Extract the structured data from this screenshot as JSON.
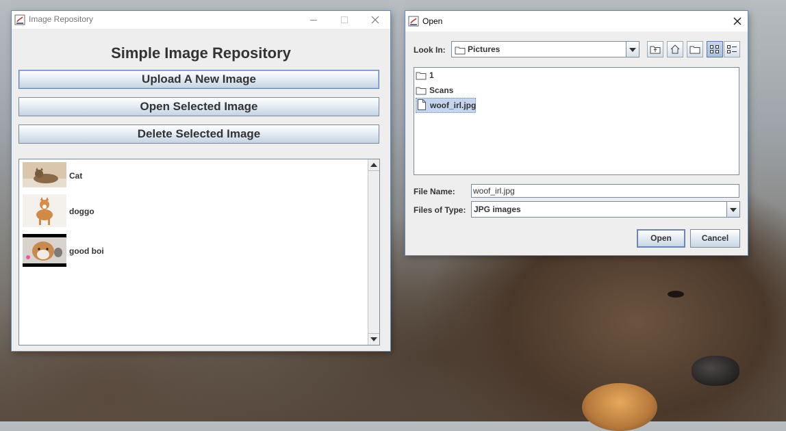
{
  "repo_window": {
    "title": "Image Repository",
    "heading": "Simple Image Repository",
    "buttons": {
      "upload": "Upload A New Image",
      "open": "Open Selected Image",
      "delete": "Delete Selected Image"
    },
    "images": [
      {
        "label": "Cat",
        "thumb": "cat-photo"
      },
      {
        "label": "doggo",
        "thumb": "shiba-photo"
      },
      {
        "label": "good boi",
        "thumb": "shiba-closeup-photo"
      }
    ]
  },
  "open_dialog": {
    "title": "Open",
    "look_in_label": "Look In:",
    "look_in_value": "Pictures",
    "toolbar_icons": [
      "up-folder-icon",
      "home-icon",
      "new-folder-icon",
      "list-view-icon",
      "details-view-icon"
    ],
    "files": [
      {
        "name": "1",
        "type": "folder"
      },
      {
        "name": "Scans",
        "type": "folder"
      },
      {
        "name": "woof_irl.jpg",
        "type": "file",
        "selected": true
      }
    ],
    "file_name_label": "File Name:",
    "file_name_value": "woof_irl.jpg",
    "files_of_type_label": "Files of Type:",
    "files_of_type_value": "JPG images",
    "open_button": "Open",
    "cancel_button": "Cancel"
  },
  "colors": {
    "window_bg": "#eeeeee",
    "button_gradient_bottom": "#c4d3e2",
    "selection": "#c4d6ef",
    "border": "#7a8a99"
  }
}
